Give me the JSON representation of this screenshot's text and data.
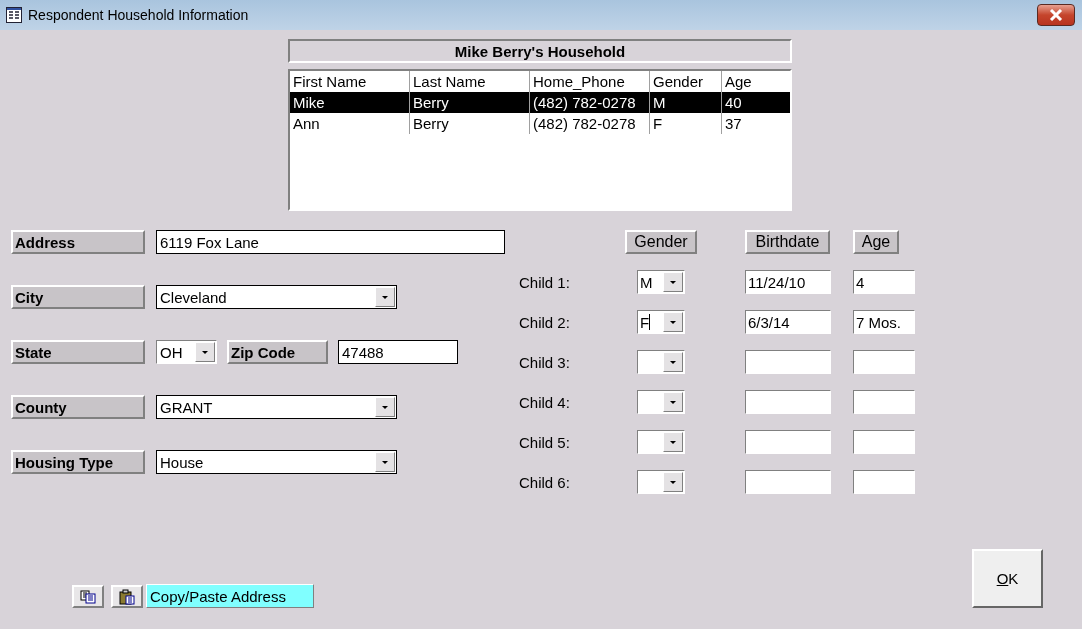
{
  "window": {
    "title": "Respondent Household Information"
  },
  "household": {
    "title": "Mike Berry's Household",
    "columns": [
      "First Name",
      "Last Name",
      "Home_Phone",
      "Gender",
      "Age"
    ],
    "rows": [
      {
        "cells": [
          "Mike",
          "Berry",
          "(482) 782-0278",
          "M",
          "40"
        ],
        "selected": true
      },
      {
        "cells": [
          "Ann",
          "Berry",
          "(482) 782-0278",
          "F",
          "37"
        ],
        "selected": false
      }
    ]
  },
  "address_rows": [
    [
      {
        "label": "Address",
        "kind": "text_wide",
        "value": "6119 Fox Lane"
      }
    ],
    [
      {
        "label": "City",
        "kind": "combo",
        "value": "Cleveland"
      }
    ],
    [
      {
        "label": "State",
        "kind": "combo_small",
        "value": "OH"
      },
      {
        "label": "Zip Code",
        "kind": "text_short",
        "value": "47488"
      }
    ],
    [
      {
        "label": "County",
        "kind": "combo",
        "value": "GRANT"
      }
    ],
    [
      {
        "label": "Housing Type",
        "kind": "combo",
        "value": "House"
      }
    ]
  ],
  "children": {
    "headers": [
      "Gender",
      "Birthdate",
      "Age"
    ],
    "rows": [
      {
        "label": "Child 1:",
        "gender": "M",
        "birthdate": "11/24/10",
        "age": "4"
      },
      {
        "label": "Child 2:",
        "gender": "F",
        "gender_focused": true,
        "birthdate": "6/3/14",
        "age": "7 Mos."
      },
      {
        "label": "Child 3:"
      },
      {
        "label": "Child 4:"
      },
      {
        "label": "Child 5:"
      },
      {
        "label": "Child 6:"
      }
    ]
  },
  "copy_paste": {
    "label": "Copy/Paste Address"
  },
  "ok_button": {
    "label": "OK",
    "mnemonic": true
  }
}
